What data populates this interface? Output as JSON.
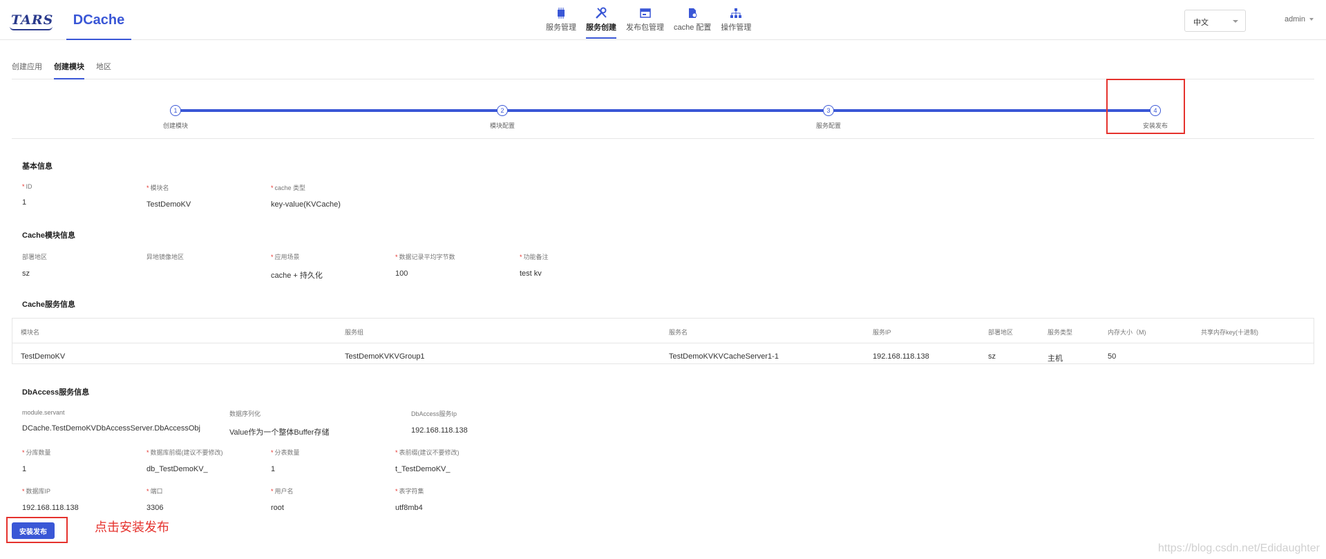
{
  "header": {
    "logo_tars": "TARS",
    "logo_dcache": "DCache",
    "nav": [
      {
        "label": "服务管理",
        "icon": "chip-icon"
      },
      {
        "label": "服务创建",
        "icon": "tools-icon"
      },
      {
        "label": "发布包管理",
        "icon": "package-icon"
      },
      {
        "label": "cache 配置",
        "icon": "config-file-icon"
      },
      {
        "label": "操作管理",
        "icon": "hierarchy-icon"
      }
    ],
    "language": "中文",
    "user": "admin"
  },
  "subtabs": [
    "创建应用",
    "创建模块",
    "地区"
  ],
  "steps": [
    {
      "num": "1",
      "label": "创建模块"
    },
    {
      "num": "2",
      "label": "模块配置"
    },
    {
      "num": "3",
      "label": "服务配置"
    },
    {
      "num": "4",
      "label": "安装发布"
    }
  ],
  "basic_info": {
    "title": "基本信息",
    "fields": [
      {
        "label": "ID",
        "required": true,
        "value": "1"
      },
      {
        "label": "模块名",
        "required": true,
        "value": "TestDemoKV"
      },
      {
        "label": "cache 类型",
        "required": true,
        "value": "key-value(KVCache)"
      }
    ]
  },
  "cache_module_info": {
    "title": "Cache模块信息",
    "fields": [
      {
        "label": "部署地区",
        "required": false,
        "value": "sz"
      },
      {
        "label": "异地镜像地区",
        "required": false,
        "value": ""
      },
      {
        "label": "应用场景",
        "required": true,
        "value": "cache + 持久化"
      },
      {
        "label": "数据记录平均字节数",
        "required": true,
        "value": "100"
      },
      {
        "label": "功能备注",
        "required": true,
        "value": "test kv"
      }
    ]
  },
  "cache_service_info": {
    "title": "Cache服务信息",
    "columns": [
      "模块名",
      "服务组",
      "服务名",
      "服务IP",
      "部署地区",
      "服务类型",
      "内存大小（M)",
      "共享内存key(十进制)"
    ],
    "rows": [
      [
        "TestDemoKV",
        "TestDemoKVKVGroup1",
        "TestDemoKVKVCacheServer1-1",
        "192.168.118.138",
        "sz",
        "主机",
        "50",
        ""
      ]
    ]
  },
  "dbaccess_info": {
    "title": "DbAccess服务信息",
    "row1": [
      {
        "label": "module.servant",
        "required": false,
        "value": "DCache.TestDemoKVDbAccessServer.DbAccessObj"
      },
      {
        "label": "数据序列化",
        "required": false,
        "value": "Value作为一个整体Buffer存储"
      },
      {
        "label": "DbAccess服务Ip",
        "required": false,
        "value": "192.168.118.138"
      }
    ],
    "row2": [
      {
        "label": "分库数量",
        "required": true,
        "value": "1"
      },
      {
        "label": "数据库前缀(建议不要修改)",
        "required": true,
        "value": "db_TestDemoKV_"
      },
      {
        "label": "分表数量",
        "required": true,
        "value": "1"
      },
      {
        "label": "表前缀(建议不要修改)",
        "required": true,
        "value": "t_TestDemoKV_"
      }
    ],
    "row3": [
      {
        "label": "数据库IP",
        "required": true,
        "value": "192.168.118.138"
      },
      {
        "label": "端口",
        "required": true,
        "value": "3306"
      },
      {
        "label": "用户名",
        "required": true,
        "value": "root"
      },
      {
        "label": "表字符集",
        "required": true,
        "value": "utf8mb4"
      }
    ]
  },
  "install_button": "安装发布",
  "annotation": "点击安装发布",
  "watermark": "https://blog.csdn.net/Edidaughter",
  "colors": {
    "accent": "#3a57d6",
    "highlight": "#e5322d"
  }
}
